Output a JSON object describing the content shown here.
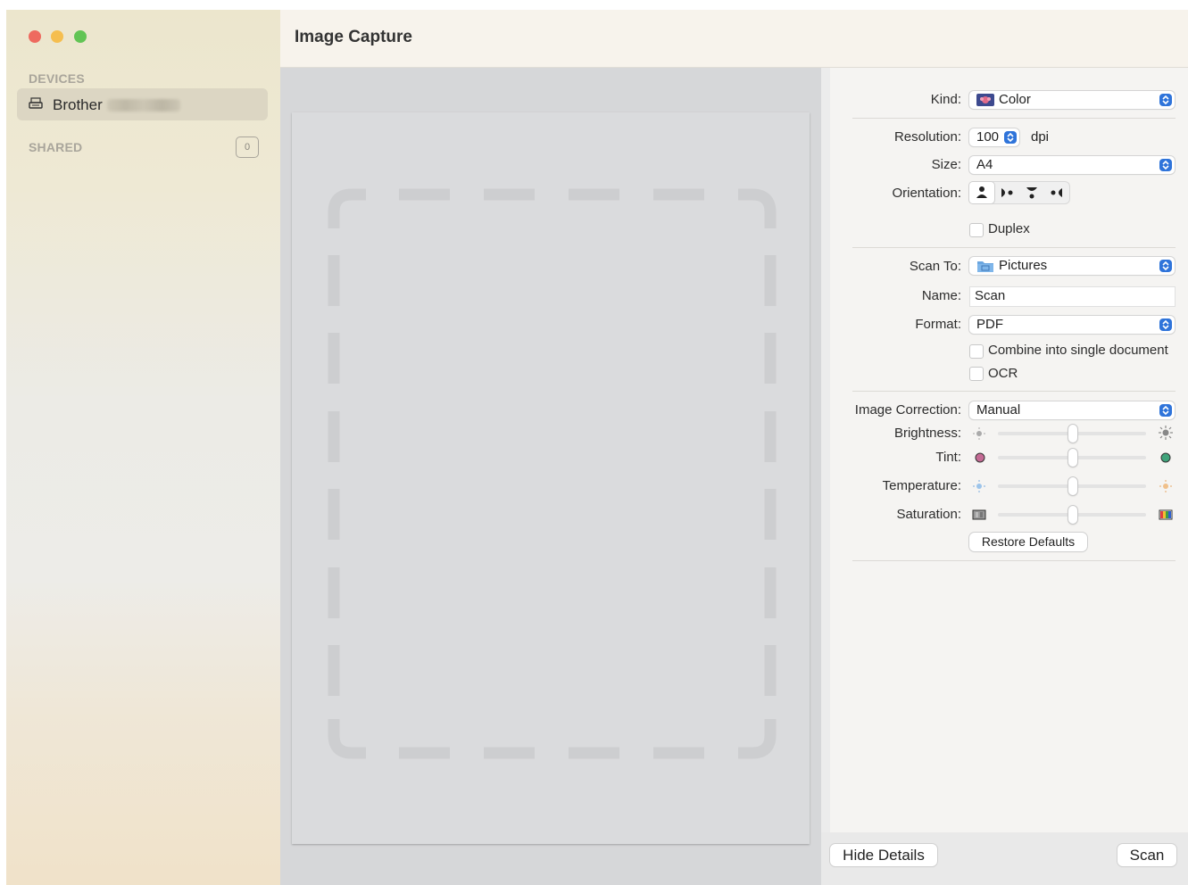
{
  "window": {
    "title": "Image Capture"
  },
  "sidebar": {
    "devices_label": "DEVICES",
    "device_name": "Brother",
    "shared_label": "SHARED",
    "shared_count": "0"
  },
  "details": {
    "kind": {
      "label": "Kind:",
      "value": "Color"
    },
    "resolution": {
      "label": "Resolution:",
      "value": "100",
      "unit": "dpi"
    },
    "size": {
      "label": "Size:",
      "value": "A4"
    },
    "orientation": {
      "label": "Orientation:",
      "options": [
        "portrait",
        "rotate-left",
        "upside-down",
        "rotate-right"
      ],
      "selected": "portrait"
    },
    "duplex": {
      "label": "Duplex",
      "checked": false
    },
    "scan_to": {
      "label": "Scan To:",
      "value": "Pictures"
    },
    "name": {
      "label": "Name:",
      "value": "Scan"
    },
    "format": {
      "label": "Format:",
      "value": "PDF"
    },
    "combine": {
      "label": "Combine into single document",
      "checked": false
    },
    "ocr": {
      "label": "OCR",
      "checked": false
    },
    "image_correction": {
      "label": "Image Correction:",
      "value": "Manual"
    },
    "brightness": {
      "label": "Brightness:",
      "level": 0.5
    },
    "tint": {
      "label": "Tint:",
      "level": 0.5
    },
    "temperature": {
      "label": "Temperature:",
      "level": 0.5
    },
    "saturation": {
      "label": "Saturation:",
      "level": 0.5
    },
    "restore_defaults": "Restore Defaults"
  },
  "bottom": {
    "hide_details": "Hide Details",
    "scan": "Scan"
  },
  "colors": {
    "accent": "#2f74da",
    "close": "#ee6a5f",
    "minimize": "#f5be4f",
    "zoom": "#62c454"
  }
}
